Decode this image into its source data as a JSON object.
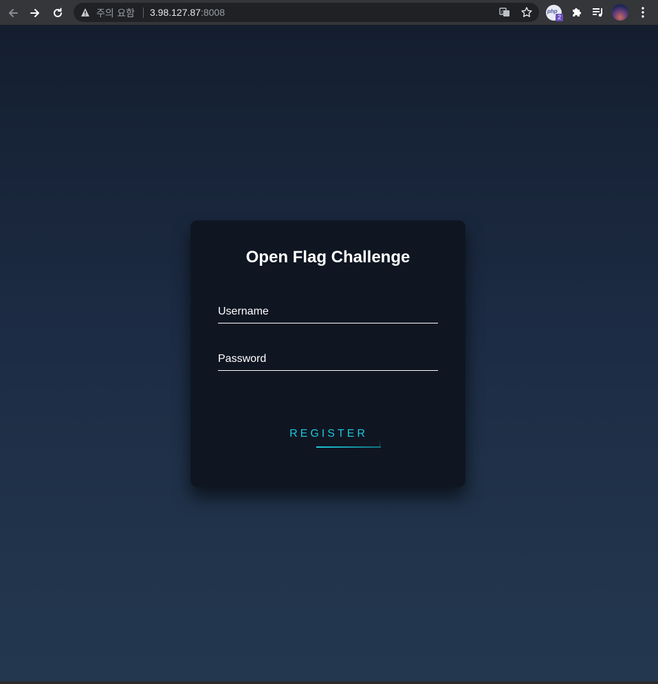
{
  "browser": {
    "security_warning": "주의 요함",
    "url_host": "3.98.127.87",
    "url_port": ":8008",
    "php_extension_label": "php",
    "extension_badge_count": "2",
    "icons": [
      "back-arrow-icon",
      "forward-arrow-icon",
      "reload-icon",
      "warning-icon",
      "translate-icon",
      "star-icon",
      "puzzle-icon",
      "media-queue-icon",
      "kebab-menu-icon"
    ]
  },
  "login_card": {
    "title": "Open Flag Challenge",
    "username_label": "Username",
    "password_label": "Password",
    "register_label": "REGISTER"
  },
  "colors": {
    "card_background": "#0f1622",
    "accent": "#1ec7da",
    "page_gradient_top": "#141e2f",
    "page_gradient_bottom": "#23384f"
  }
}
